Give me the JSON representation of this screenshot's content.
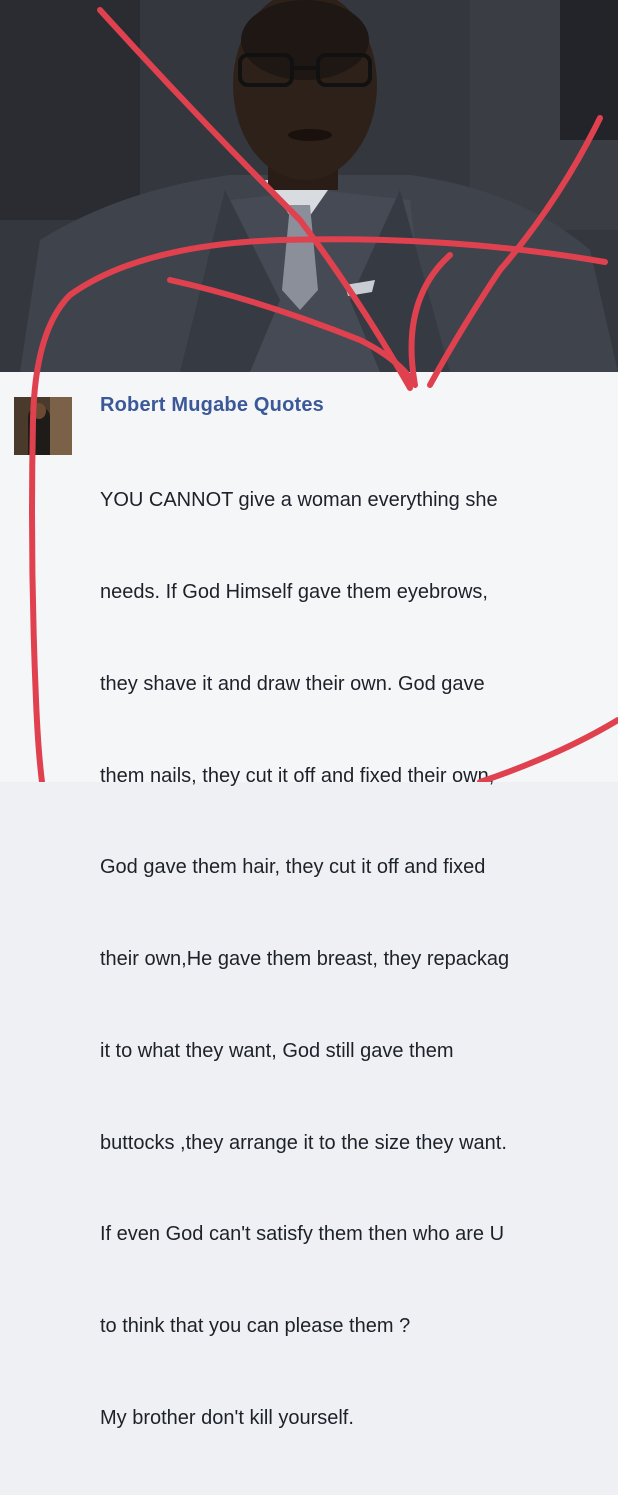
{
  "post": {
    "page_name": "Robert Mugabe Quotes",
    "lines": [
      "YOU CANNOT give a woman everything she",
      "needs. If God Himself gave them eyebrows,",
      "they shave it and draw their own. God gave",
      "them nails, they cut it off and fixed their own,",
      "God gave them hair, they cut it off and fixed",
      "their own,He gave them breast, they repackag",
      "it to what they want, God still gave them",
      "buttocks ,they arrange it to the size they want.",
      "If even God can't satisfy them then who are U",
      "to think that you can please them ?",
      "My brother don't kill yourself."
    ]
  },
  "colors": {
    "link_blue": "#3b5998",
    "text": "#1d2129",
    "annotation_red": "#e0414f"
  }
}
